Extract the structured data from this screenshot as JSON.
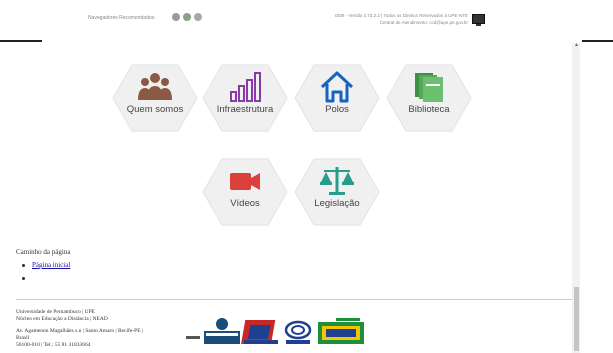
{
  "header": {
    "recommended_browsers": "Navegadores Recomendados:",
    "version": "ODB - Versão 3.72.2.2 | Todos os Direitos Reservados à UPE-NTE",
    "support": "Central de Atendimento: ccd@upe.pe.gov.br"
  },
  "tiles": [
    {
      "label": "Quem somos",
      "icon": "people-icon",
      "color": "#8a5a44"
    },
    {
      "label": "Infraestrutura",
      "icon": "bar-chart-icon",
      "color": "#8a3aa8"
    },
    {
      "label": "Polos",
      "icon": "home-icon",
      "color": "#1565c0"
    },
    {
      "label": "Biblioteca",
      "icon": "books-icon",
      "color": "#55a85a"
    },
    {
      "label": "Vídeos",
      "icon": "video-camera-icon",
      "color": "#d9413a"
    },
    {
      "label": "Legislação",
      "icon": "scales-icon",
      "color": "#2a9c8c"
    }
  ],
  "breadcrumb": {
    "title": "Caminho da página",
    "items": [
      "Página inicial",
      ""
    ]
  },
  "footer": {
    "lines": [
      "Universidade de Pernambuco | UPE",
      "Núcleo em Educação a Distância | NEAD",
      "",
      "Av. Agamenon Magalhães s.n | Santo Amaro | Recife-PE |",
      "Brasil",
      "50100-010 | Tel.: 55 81 31833664"
    ],
    "logos": [
      "Governo de Pernambuco",
      "UPE",
      "CAPES",
      "Brasil"
    ]
  }
}
